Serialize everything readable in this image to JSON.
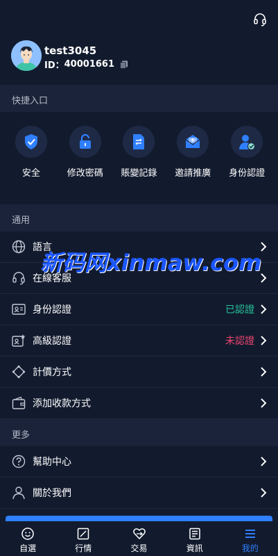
{
  "header": {
    "headset_icon": "headset-icon"
  },
  "profile": {
    "username": "test3045",
    "id_label": "ID：",
    "id_value": "40001661",
    "copy_icon": "copy-icon"
  },
  "quick_section": {
    "title": "快捷入口",
    "items": [
      {
        "label": "安全",
        "icon": "shield-icon"
      },
      {
        "label": "修改密碼",
        "icon": "lock-icon"
      },
      {
        "label": "賬變記錄",
        "icon": "document-icon"
      },
      {
        "label": "邀請推廣",
        "icon": "envelope-icon"
      },
      {
        "label": "身份認證",
        "icon": "user-verified-icon"
      }
    ]
  },
  "general_section": {
    "title": "通用",
    "rows": [
      {
        "label": "語言",
        "status": "",
        "icon": "globe-icon"
      },
      {
        "label": "在線客服",
        "status": "",
        "icon": "headset-icon"
      },
      {
        "label": "身份認證",
        "status": "已認證",
        "status_color": "#27c59a",
        "icon": "id-card-icon"
      },
      {
        "label": "高級認證",
        "status": "未認證",
        "status_color": "#f0466e",
        "icon": "advanced-id-icon"
      },
      {
        "label": "計價方式",
        "status": "",
        "icon": "pricing-icon"
      },
      {
        "label": "添加收款方式",
        "status": "",
        "icon": "wallet-icon"
      }
    ]
  },
  "more_section": {
    "title": "更多",
    "rows": [
      {
        "label": "幫助中心",
        "icon": "help-icon"
      },
      {
        "label": "關於我們",
        "icon": "person-icon"
      }
    ]
  },
  "watermark": "新码网xinmaw.com",
  "tabs": [
    {
      "label": "自選",
      "icon": "smiley-icon",
      "active": false
    },
    {
      "label": "行情",
      "icon": "chart-icon",
      "active": false
    },
    {
      "label": "交易",
      "icon": "trade-icon",
      "active": false
    },
    {
      "label": "資訊",
      "icon": "news-icon",
      "active": false
    },
    {
      "label": "我的",
      "icon": "menu-icon",
      "active": true
    }
  ],
  "colors": {
    "accent": "#2f7fff",
    "verified": "#27c59a",
    "unverified": "#f0466e"
  }
}
